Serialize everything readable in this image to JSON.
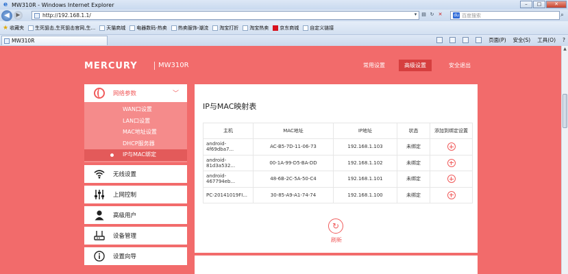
{
  "browser": {
    "title": "MW310R - Windows Internet Explorer",
    "url": "http://192.168.1.1/",
    "search_placeholder": "百度搜索",
    "window_buttons": [
      "–",
      "□",
      "✕"
    ],
    "favorites_label": "收藏夹",
    "favorites": [
      "生死狙击,生死狙击官网,生...",
      "天猫商城",
      "电器数码-热卖",
      "热卖服饰-潮流",
      "淘宝打折",
      "淘宝热卖",
      "京东商城",
      "自定义链接"
    ],
    "tab_title": "MW310R",
    "commands": [
      "页面(P)",
      "安全(S)",
      "工具(O)"
    ]
  },
  "header": {
    "logo": "MERCURY",
    "model": "MW310R",
    "nav": [
      {
        "label": "常用设置"
      },
      {
        "label": "高级设置",
        "active": true
      },
      {
        "label": "安全退出"
      }
    ]
  },
  "sidebar": {
    "group_title": "网络参数",
    "sub_items": [
      "WAN口设置",
      "LAN口设置",
      "MAC地址设置",
      "DHCP服务器",
      "IP与MAC绑定"
    ],
    "active_sub_item": "IP与MAC绑定",
    "items": [
      {
        "label": "无线设置",
        "icon": "wifi-icon"
      },
      {
        "label": "上网控制",
        "icon": "sliders-icon"
      },
      {
        "label": "高级用户",
        "icon": "user-icon"
      },
      {
        "label": "设备管理",
        "icon": "router-icon"
      },
      {
        "label": "设置向导",
        "icon": "info-icon"
      }
    ]
  },
  "main": {
    "title": "IP与MAC映射表",
    "columns": [
      "主机",
      "MAC地址",
      "IP地址",
      "状态",
      "添加到绑定设置"
    ],
    "rows": [
      {
        "host": "android-4f69dba7...",
        "mac": "AC-B5-7D-11-06-73",
        "ip": "192.168.1.103",
        "status": "未绑定"
      },
      {
        "host": "android-81d3a532...",
        "mac": "00-1A-99-D5-BA-DD",
        "ip": "192.168.1.102",
        "status": "未绑定"
      },
      {
        "host": "android-467794eb...",
        "mac": "48-6B-2C-5A-50-C4",
        "ip": "192.168.1.101",
        "status": "未绑定"
      },
      {
        "host": "PC-20141019FI...",
        "mac": "30-85-A9-A1-74-74",
        "ip": "192.168.1.100",
        "status": "未绑定"
      }
    ],
    "refresh_label": "刷新"
  },
  "colors": {
    "brand_red": "#f26b6b",
    "accent_red": "#f05a5a",
    "active_nav": "#d63f3f"
  }
}
